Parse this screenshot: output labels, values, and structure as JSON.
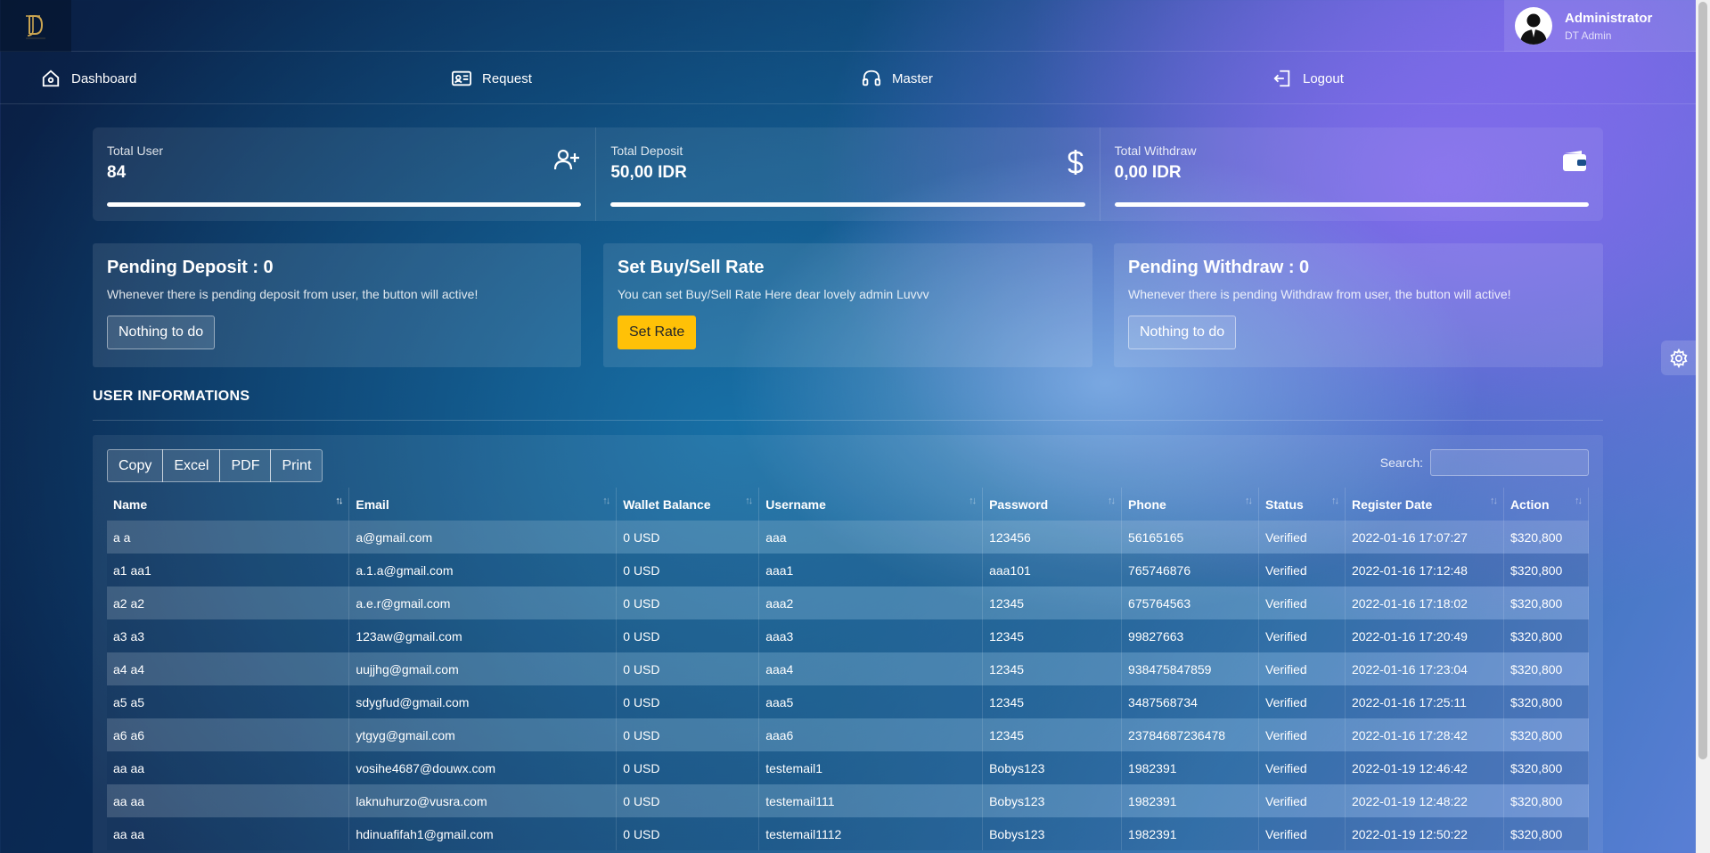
{
  "header": {
    "admin_name": "Administrator",
    "admin_role": "DT Admin"
  },
  "nav": {
    "dashboard": "Dashboard",
    "request": "Request",
    "master": "Master",
    "logout": "Logout"
  },
  "stats": [
    {
      "label": "Total User",
      "value": "84",
      "icon": "user-plus-icon",
      "progress": 1.0
    },
    {
      "label": "Total Deposit",
      "value": "50,00 IDR",
      "icon": "dollar-icon",
      "progress": 1.0
    },
    {
      "label": "Total Withdraw",
      "value": "0,00 IDR",
      "icon": "wallet-icon",
      "progress": 1.0
    }
  ],
  "cards": {
    "deposit": {
      "title": "Pending Deposit : 0",
      "desc": "Whenever there is pending deposit from user, the button will active!",
      "button": "Nothing to do"
    },
    "rate": {
      "title": "Set Buy/Sell Rate",
      "desc": "You can set Buy/Sell Rate Here dear lovely admin Luvvv",
      "button": "Set Rate"
    },
    "withdraw": {
      "title": "Pending Withdraw : 0",
      "desc": "Whenever there is pending Withdraw from user, the button will active!",
      "button": "Nothing to do"
    }
  },
  "section": {
    "title": "USER INFORMATIONS"
  },
  "table": {
    "buttons": {
      "copy": "Copy",
      "excel": "Excel",
      "pdf": "PDF",
      "print": "Print"
    },
    "search_label": "Search:",
    "columns": [
      "Name",
      "Email",
      "Wallet Balance",
      "Username",
      "Password",
      "Phone",
      "Status",
      "Register Date",
      "Action"
    ],
    "rows": [
      [
        "a a",
        "a@gmail.com",
        "0 USD",
        "aaa",
        "123456",
        "56165165",
        "Verified",
        "2022-01-16 17:07:27",
        "$320,800"
      ],
      [
        "a1 aa1",
        "a.1.a@gmail.com",
        "0 USD",
        "aaa1",
        "aaa101",
        "765746876",
        "Verified",
        "2022-01-16 17:12:48",
        "$320,800"
      ],
      [
        "a2 a2",
        "a.e.r@gmail.com",
        "0 USD",
        "aaa2",
        "12345",
        "675764563",
        "Verified",
        "2022-01-16 17:18:02",
        "$320,800"
      ],
      [
        "a3 a3",
        "123aw@gmail.com",
        "0 USD",
        "aaa3",
        "12345",
        "99827663",
        "Verified",
        "2022-01-16 17:20:49",
        "$320,800"
      ],
      [
        "a4 a4",
        "uujjhg@gmail.com",
        "0 USD",
        "aaa4",
        "12345",
        "938475847859",
        "Verified",
        "2022-01-16 17:23:04",
        "$320,800"
      ],
      [
        "a5 a5",
        "sdygfud@gmail.com",
        "0 USD",
        "aaa5",
        "12345",
        "3487568734",
        "Verified",
        "2022-01-16 17:25:11",
        "$320,800"
      ],
      [
        "a6 a6",
        "ytgyg@gmail.com",
        "0 USD",
        "aaa6",
        "12345",
        "23784687236478",
        "Verified",
        "2022-01-16 17:28:42",
        "$320,800"
      ],
      [
        "aa aa",
        "vosihe4687@douwx.com",
        "0 USD",
        "testemail1",
        "Bobys123",
        "1982391",
        "Verified",
        "2022-01-19 12:46:42",
        "$320,800"
      ],
      [
        "aa aa",
        "laknuhurzo@vusra.com",
        "0 USD",
        "testemail111",
        "Bobys123",
        "1982391",
        "Verified",
        "2022-01-19 12:48:22",
        "$320,800"
      ],
      [
        "aa aa",
        "hdinuafifah1@gmail.com",
        "0 USD",
        "testemail1112",
        "Bobys123",
        "1982391",
        "Verified",
        "2022-01-19 12:50:22",
        "$320,800"
      ]
    ]
  },
  "colors": {
    "accent_button": "#ffc107",
    "logo_gold": "#c9a451"
  }
}
